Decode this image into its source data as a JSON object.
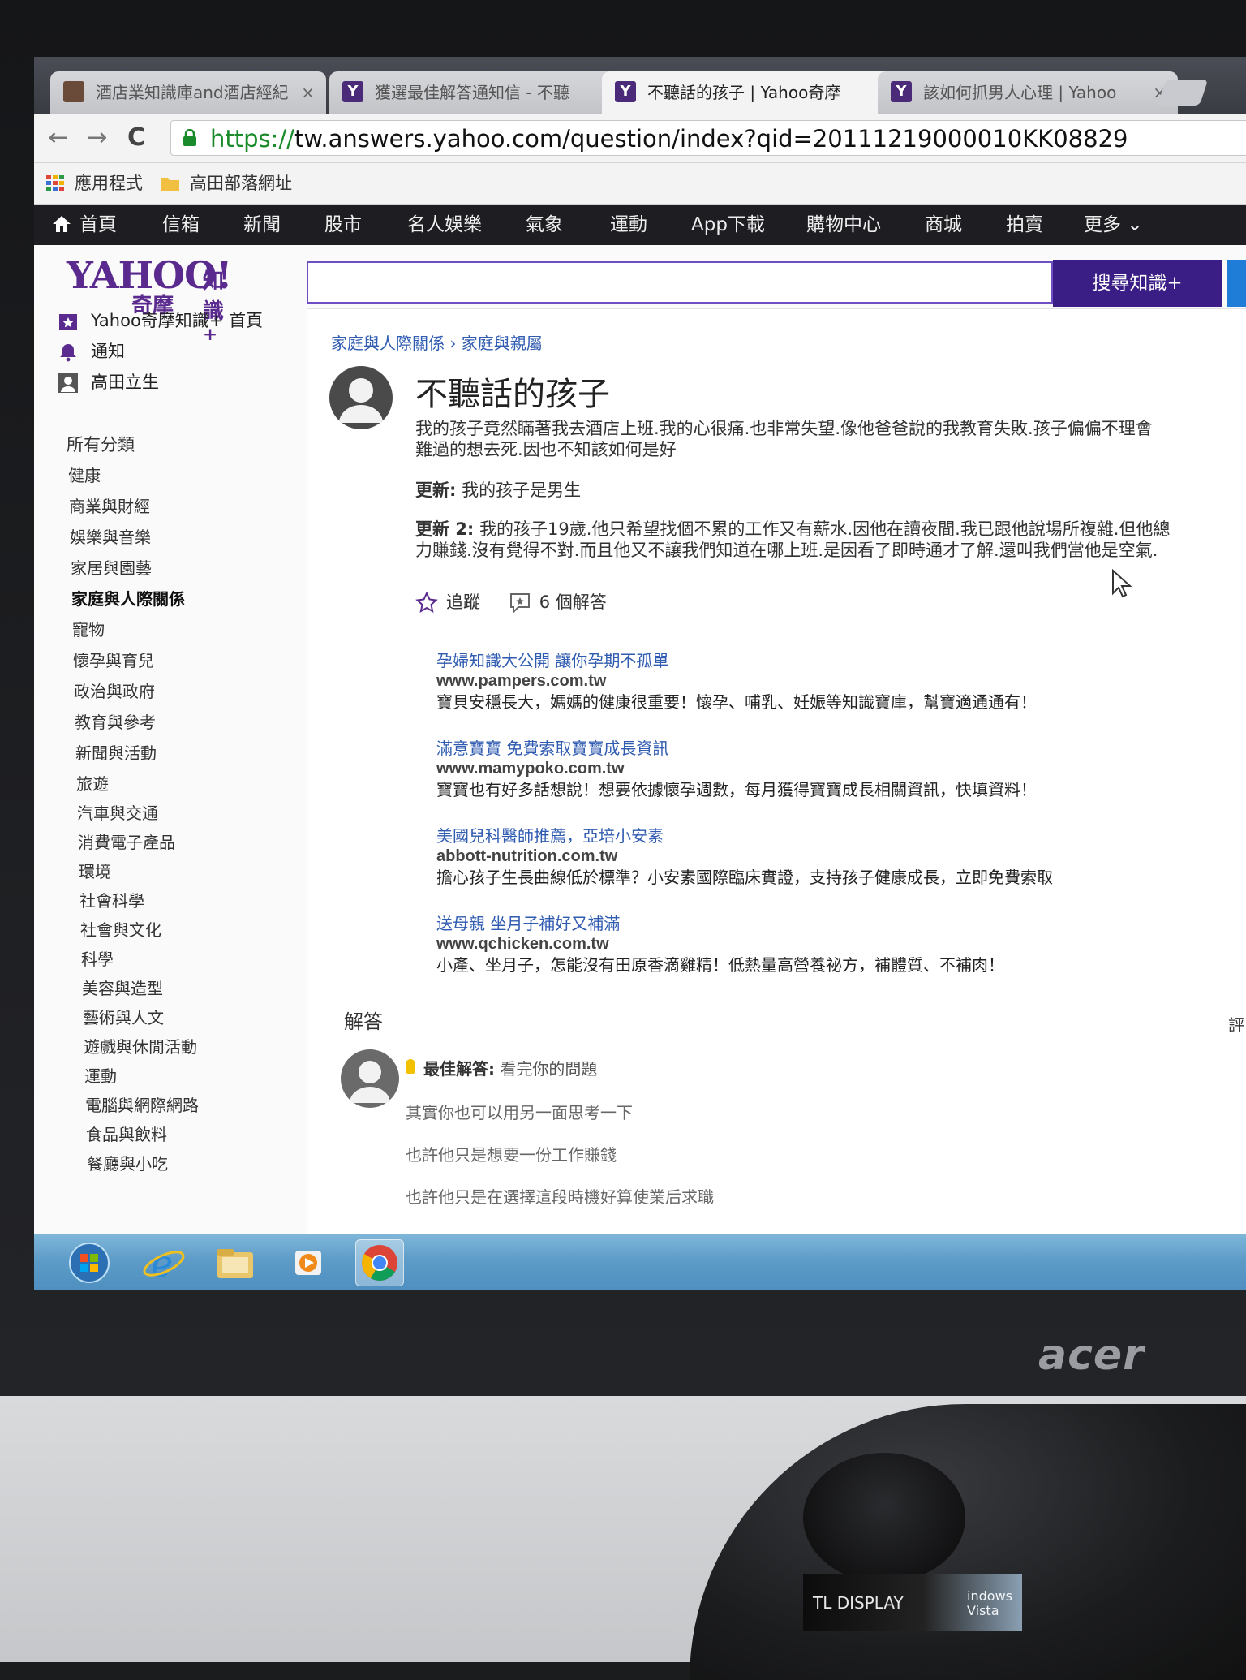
{
  "browser": {
    "tabs": [
      {
        "title": "酒店業知識庫and酒店經紀",
        "close": "×",
        "favicon": "hotel-favicon"
      },
      {
        "title": "獲選最佳解答通知信 - 不聽",
        "close": "×",
        "favicon": "Y"
      },
      {
        "title": "不聽話的孩子 | Yahoo奇摩",
        "close": "×",
        "favicon": "Y"
      },
      {
        "title": "該如何抓男人心理 | Yahoo",
        "close": "×",
        "favicon": "Y"
      }
    ],
    "active_tab": 2,
    "url_protocol": "https://",
    "url_rest": "tw.answers.yahoo.com/question/index?qid=20111219000010KK08829",
    "nav": {
      "back": "←",
      "forward": "→",
      "reload": "C"
    },
    "bookmarks": [
      {
        "label": "應用程式",
        "icon": "apps-icon"
      },
      {
        "label": "高田部落網址",
        "icon": "folder-icon"
      }
    ]
  },
  "ynav": {
    "items": [
      "首頁",
      "信箱",
      "新聞",
      "股市",
      "名人娛樂",
      "氣象",
      "運動",
      "App下載",
      "購物中心",
      "商城",
      "拍賣",
      "更多"
    ],
    "more_chevron": "⌄"
  },
  "logo": {
    "main": "YAHOO!",
    "sub": "奇摩",
    "product": "知識",
    "plus": "+"
  },
  "search": {
    "button": "搜尋知識+",
    "placeholder": ""
  },
  "sidebar": {
    "links": [
      {
        "label": "Yahoo奇摩知識+ 首頁",
        "icon": "star-badge-icon"
      },
      {
        "label": "通知",
        "icon": "bell-icon"
      },
      {
        "label": "高田立生",
        "icon": "user-icon"
      }
    ],
    "categories_heading": "所有分類",
    "categories": [
      "健康",
      "商業與財經",
      "娛樂與音樂",
      "家居與園藝",
      "家庭與人際關係",
      "寵物",
      "懷孕與育兒",
      "政治與政府",
      "教育與參考",
      "新聞與活動",
      "旅遊",
      "汽車與交通",
      "消費電子產品",
      "環境",
      "社會科學",
      "社會與文化",
      "科學",
      "美容與造型",
      "藝術與人文",
      "遊戲與休閒活動",
      "運動",
      "電腦與網際網路",
      "食品與飲料",
      "餐廳與小吃"
    ],
    "current_category": "家庭與人際關係"
  },
  "question": {
    "breadcrumb": [
      "家庭與人際關係",
      "家庭與親屬"
    ],
    "breadcrumb_sep": "›",
    "title": "不聽話的孩子",
    "body_line1": "我的孩子竟然瞞著我去酒店上班.我的心很痛.也非常失望.像他爸爸說的我教育失敗.孩子偏偏不理會",
    "body_line2": "難過的想去死.因也不知該如何是好",
    "update1_label": "更新:",
    "update1_text": "我的孩子是男生",
    "update2_label": "更新 2:",
    "update2_line1": "我的孩子19歲.他只希望找個不累的工作又有薪水.因他在讀夜間.我已跟他說場所複雜.但他總",
    "update2_line2": "力賺錢.沒有覺得不對.而且他又不讓我們知道在哪上班.是因看了即時通才了解.還叫我們當他是空氣.",
    "follow": "追蹤",
    "answers_count": "6 個解答"
  },
  "ads": [
    {
      "title": "孕婦知識大公開 讓你孕期不孤單",
      "url": "www.pampers.com.tw",
      "desc": "寶貝安穩長大，媽媽的健康很重要！懷孕、哺乳、妊娠等知識寶庫，幫寶適通通有！"
    },
    {
      "title": "滿意寶寶 免費索取寶寶成長資訊",
      "url": "www.mamypoko.com.tw",
      "desc": "寶寶也有好多話想說！想要依據懷孕週數，每月獲得寶寶成長相關資訊，快填資料！"
    },
    {
      "title": "美國兒科醫師推薦，亞培小安素",
      "url": "abbott-nutrition.com.tw",
      "desc": "擔心孩子生長曲線低於標準？小安素國際臨床實證，支持孩子健康成長，立即免費索取"
    },
    {
      "title": "送母親 坐月子補好又補滿",
      "url": "www.qchicken.com.tw",
      "desc": "小產、坐月子，怎能沒有田原香滴雞精！低熱量高營養祕方，補體質、不補肉！"
    }
  ],
  "answers": {
    "heading": "解答",
    "rate_label": "評",
    "best_label": "最佳解答:",
    "best_first": "看完你的問題",
    "lines": [
      "其實你也可以用另一面思考一下",
      "也許他只是想要一份工作賺錢",
      "也許他只是在選擇這段時機好算使業后求職"
    ]
  },
  "monitor": {
    "brand": "acer",
    "sticker_left": "TL DISPLAY",
    "sticker_right_top": "indows",
    "sticker_right_bottom": "Vista"
  },
  "taskbar": {
    "items": [
      "start-orb-icon",
      "ie-icon",
      "explorer-icon",
      "media-player-icon",
      "chrome-icon"
    ]
  },
  "colors": {
    "yahoo_purple": "#5a2a8f",
    "search_button": "#3b1d86",
    "link_blue": "#2f5bb1",
    "url_green": "#1a8b2a"
  }
}
